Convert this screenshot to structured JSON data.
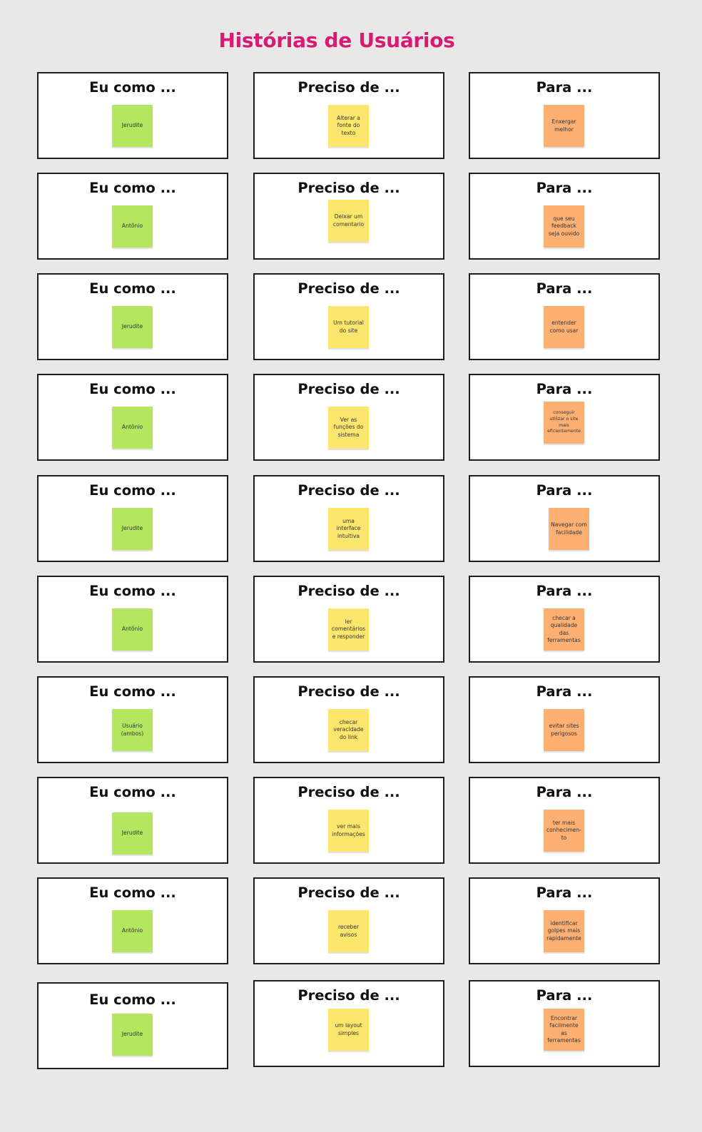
{
  "board": {
    "title": "Histórias de Usuários"
  },
  "columns": {
    "who": "Eu como ...",
    "need": "Preciso de ...",
    "goal": "Para ..."
  },
  "colors": {
    "title": "#d81b72",
    "who_note": "#b4e660",
    "need_note": "#fde66e",
    "goal_note": "#fdb073",
    "frame_border": "#1e1e1e",
    "canvas": "#e8e8e8"
  },
  "stories": [
    {
      "who": "Jerudite",
      "need": "Alterar a fonte do texto",
      "goal": "Enxergar melhor"
    },
    {
      "who": "Antônio",
      "need": "Deixar um comentario",
      "goal": "que seu feedback seja ouvido"
    },
    {
      "who": "Jerudite",
      "need": "Um tutorial do site",
      "goal": "entender como usar"
    },
    {
      "who": "Antônio",
      "need": "Ver as funções do sistema",
      "goal": "conseguir utilizar o site mais eficientemente"
    },
    {
      "who": "Jerudite",
      "need": "uma interface intuitiva",
      "goal": "Navegar com facilidade"
    },
    {
      "who": "Antônio",
      "need": "ler comentários e responder",
      "goal": "checar a qualidade das ferramentas"
    },
    {
      "who": "Usuário (ambos)",
      "need": "checar veracidade do link",
      "goal": "evitar sites perigosos"
    },
    {
      "who": "Jerudite",
      "need": "ver mais informações",
      "goal": "ter mais conhecimen-to"
    },
    {
      "who": "Antônio",
      "need": "receber avisos",
      "goal": "identificar golpes mais rapidamente"
    },
    {
      "who": "Jerudite",
      "need": "um layout simples",
      "goal": "Encontrar facilmente as ferramentas"
    }
  ]
}
